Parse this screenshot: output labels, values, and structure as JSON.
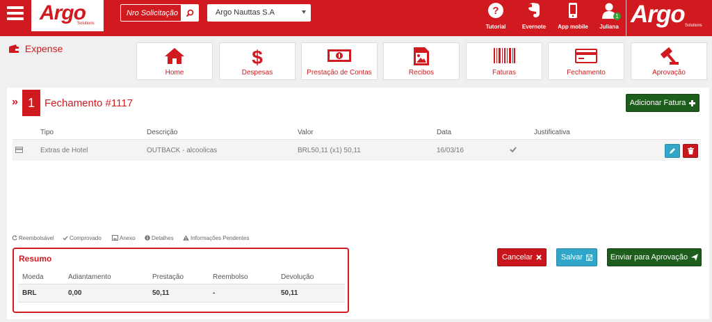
{
  "header": {
    "brand": "Argo",
    "brand_sub": "Solutions",
    "search_placeholder": "Nro Solicitação",
    "company": "Argo Nauttas S.A",
    "icons": [
      {
        "label": "Tutorial",
        "icon": "question-circle-icon"
      },
      {
        "label": "Evernote",
        "icon": "evernote-icon"
      },
      {
        "label": "App mobile",
        "icon": "mobile-phone-icon"
      },
      {
        "label": "Juliana",
        "icon": "user-icon",
        "badge": "1"
      }
    ]
  },
  "module": {
    "title": "Expense",
    "nav": [
      {
        "label": "Home",
        "icon": "home-icon"
      },
      {
        "label": "Despesas",
        "icon": "dollar-icon"
      },
      {
        "label": "Prestação de Contas",
        "icon": "money-bill-icon"
      },
      {
        "label": "Recibos",
        "icon": "image-icon"
      },
      {
        "label": "Faturas",
        "icon": "barcode-icon"
      },
      {
        "label": "Fechamento",
        "icon": "credit-card-icon"
      },
      {
        "label": "Aprovação",
        "icon": "gavel-icon"
      }
    ]
  },
  "closing": {
    "chevrons": "»",
    "step": "1",
    "title": "Fechamento #1117",
    "add_invoice_label": "Adicionar Fatura",
    "columns": [
      "Tipo",
      "Descrição",
      "Valor",
      "Data",
      "Justificativa"
    ],
    "rows": [
      {
        "tipo": "Extras de Hotel",
        "descricao": "OUTBACK - alcoolicas",
        "valor": "BRL50,11 (x1) 50,11",
        "data": "16/03/16",
        "justificativa": ""
      }
    ],
    "legend": [
      "Reembolsável",
      "Comprovado",
      "Anexo",
      "Detalhes",
      "Informações Pendentes"
    ]
  },
  "summary": {
    "title": "Resumo",
    "columns": [
      "Moeda",
      "Adiantamento",
      "Prestação",
      "Reembolso",
      "Devolução"
    ],
    "row": {
      "moeda": "BRL",
      "adiantamento": "0,00",
      "prestacao": "50,11",
      "reembolso": "-",
      "devolucao": "50,11"
    }
  },
  "actions": {
    "cancel_label": "Cancelar",
    "save_label": "Salvar",
    "send_label": "Enviar para Aprovação"
  },
  "colors": {
    "brand": "#d11a1f",
    "green": "#1e5e1c",
    "blue": "#32a6c8"
  }
}
